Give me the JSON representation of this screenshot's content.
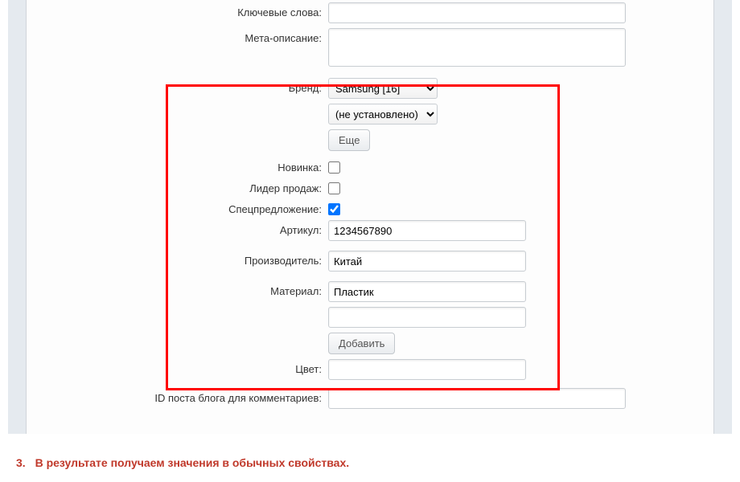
{
  "labels": {
    "keywords": "Ключевые слова:",
    "meta_description": "Мета-описание:",
    "brand": "Бренд:",
    "more_btn": "Еще",
    "new_product": "Новинка:",
    "bestseller": "Лидер продаж:",
    "special_offer": "Спецпредложение:",
    "sku": "Артикул:",
    "manufacturer": "Производитель:",
    "material": "Материал:",
    "add_btn": "Добавить",
    "color": "Цвет:",
    "blog_post_id": "ID поста блога для комментариев:"
  },
  "values": {
    "keywords": "",
    "meta_description": "",
    "brand_selected": "Samsung [16]",
    "brand_unset": "(не установлено)",
    "new_product": false,
    "bestseller": false,
    "special_offer": true,
    "sku": "1234567890",
    "manufacturer": "Китай",
    "material": "Пластик",
    "material_extra": "",
    "color": "",
    "blog_post_id": ""
  },
  "note": {
    "number": "3.",
    "text": "В результате получаем значения в обычных свойствах."
  }
}
